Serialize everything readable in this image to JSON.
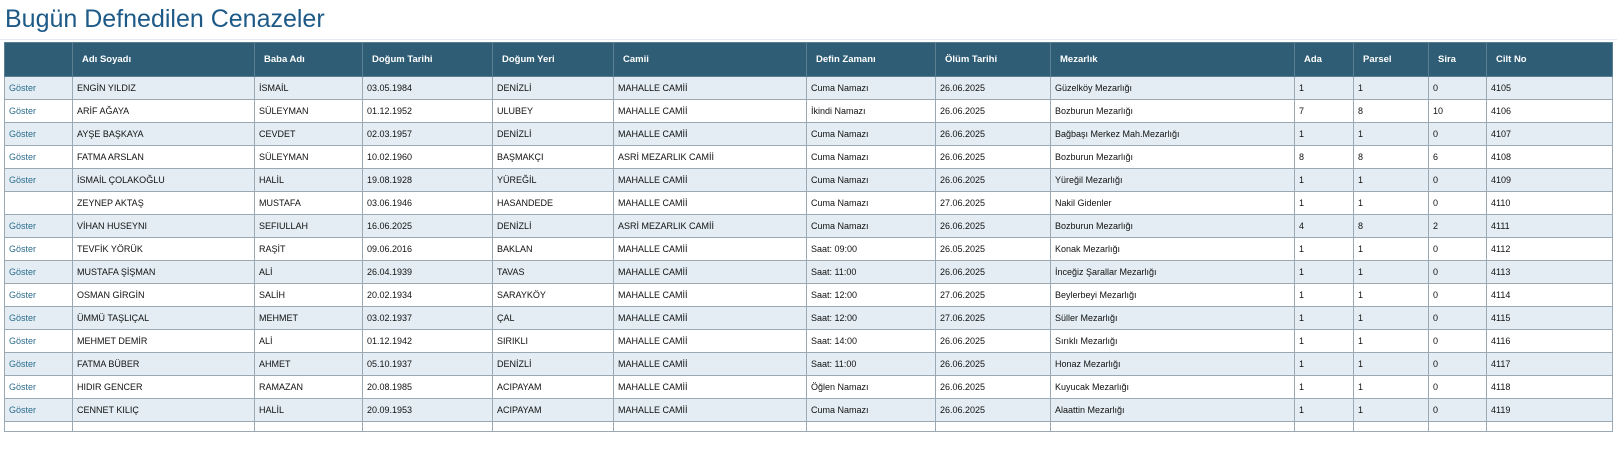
{
  "page": {
    "title": "Bugün Defnedilen Cenazeler"
  },
  "table": {
    "headers": [
      "",
      "Adı Soyadı",
      "Baba Adı",
      "Doğum Tarihi",
      "Doğum Yeri",
      "Camii",
      "Defin Zamanı",
      "Ölüm Tarihi",
      "Mezarlık",
      "Ada",
      "Parsel",
      "Sira",
      "Cilt No"
    ],
    "action_label": "Göster",
    "rows": [
      {
        "action": "Göster",
        "name": "ENGİN YILDIZ",
        "father": "İSMAİL",
        "birth_date": "03.05.1984",
        "birth_place": "DENİZLİ",
        "mosque": "MAHALLE CAMİİ",
        "burial_time": "Cuma Namazı",
        "death_date": "26.06.2025",
        "cemetery": "Güzelköy Mezarlığı",
        "ada": "1",
        "parsel": "1",
        "sira": "0",
        "cilt_no": "4105"
      },
      {
        "action": "Göster",
        "name": "ARİF AĞAYA",
        "father": "SÜLEYMAN",
        "birth_date": "01.12.1952",
        "birth_place": "ULUBEY",
        "mosque": "MAHALLE CAMİİ",
        "burial_time": "İkindi Namazı",
        "death_date": "26.06.2025",
        "cemetery": "Bozburun Mezarlığı",
        "ada": "7",
        "parsel": "8",
        "sira": "10",
        "cilt_no": "4106"
      },
      {
        "action": "Göster",
        "name": "AYŞE BAŞKAYA",
        "father": "CEVDET",
        "birth_date": "02.03.1957",
        "birth_place": "DENİZLİ",
        "mosque": "MAHALLE CAMİİ",
        "burial_time": "Cuma Namazı",
        "death_date": "26.06.2025",
        "cemetery": "Bağbaşı Merkez Mah.Mezarlığı",
        "ada": "1",
        "parsel": "1",
        "sira": "0",
        "cilt_no": "4107"
      },
      {
        "action": "Göster",
        "name": "FATMA ARSLAN",
        "father": "SÜLEYMAN",
        "birth_date": "10.02.1960",
        "birth_place": "BAŞMAKÇI",
        "mosque": "ASRİ MEZARLIK CAMİİ",
        "burial_time": "Cuma Namazı",
        "death_date": "26.06.2025",
        "cemetery": "Bozburun Mezarlığı",
        "ada": "8",
        "parsel": "8",
        "sira": "6",
        "cilt_no": "4108"
      },
      {
        "action": "Göster",
        "name": "İSMAİL ÇOLAKOĞLU",
        "father": "HALİL",
        "birth_date": "19.08.1928",
        "birth_place": "YÜREĞİL",
        "mosque": "MAHALLE CAMİİ",
        "burial_time": "Cuma Namazı",
        "death_date": "26.06.2025",
        "cemetery": "Yüreğil Mezarlığı",
        "ada": "1",
        "parsel": "1",
        "sira": "0",
        "cilt_no": "4109"
      },
      {
        "action": "",
        "name": "ZEYNEP AKTAŞ",
        "father": "MUSTAFA",
        "birth_date": "03.06.1946",
        "birth_place": "HASANDEDE",
        "mosque": "MAHALLE CAMİİ",
        "burial_time": "Cuma Namazı",
        "death_date": "27.06.2025",
        "cemetery": "Nakil Gidenler",
        "ada": "1",
        "parsel": "1",
        "sira": "0",
        "cilt_no": "4110"
      },
      {
        "action": "Göster",
        "name": "VİHAN HUSEYNI",
        "father": "SEFIULLAH",
        "birth_date": "16.06.2025",
        "birth_place": "DENİZLİ",
        "mosque": "ASRİ MEZARLIK CAMİİ",
        "burial_time": "Cuma Namazı",
        "death_date": "26.06.2025",
        "cemetery": "Bozburun Mezarlığı",
        "ada": "4",
        "parsel": "8",
        "sira": "2",
        "cilt_no": "4111"
      },
      {
        "action": "Göster",
        "name": "TEVFİK YÖRÜK",
        "father": "RAŞİT",
        "birth_date": "09.06.2016",
        "birth_place": "BAKLAN",
        "mosque": "MAHALLE CAMİİ",
        "burial_time": "Saat: 09:00",
        "death_date": "26.05.2025",
        "cemetery": "Konak Mezarlığı",
        "ada": "1",
        "parsel": "1",
        "sira": "0",
        "cilt_no": "4112"
      },
      {
        "action": "Göster",
        "name": "MUSTAFA ŞİŞMAN",
        "father": "ALİ",
        "birth_date": "26.04.1939",
        "birth_place": "TAVAS",
        "mosque": "MAHALLE CAMİİ",
        "burial_time": "Saat: 11:00",
        "death_date": "26.06.2025",
        "cemetery": "İnceğiz Şarallar Mezarlığı",
        "ada": "1",
        "parsel": "1",
        "sira": "0",
        "cilt_no": "4113"
      },
      {
        "action": "Göster",
        "name": "OSMAN GİRGİN",
        "father": "SALİH",
        "birth_date": "20.02.1934",
        "birth_place": "SARAYKÖY",
        "mosque": "MAHALLE CAMİİ",
        "burial_time": "Saat: 12:00",
        "death_date": "27.06.2025",
        "cemetery": "Beylerbeyi Mezarlığı",
        "ada": "1",
        "parsel": "1",
        "sira": "0",
        "cilt_no": "4114"
      },
      {
        "action": "Göster",
        "name": "ÜMMÜ TAŞLIÇAL",
        "father": "MEHMET",
        "birth_date": "03.02.1937",
        "birth_place": "ÇAL",
        "mosque": "MAHALLE CAMİİ",
        "burial_time": "Saat: 12:00",
        "death_date": "27.06.2025",
        "cemetery": "Süller Mezarlığı",
        "ada": "1",
        "parsel": "1",
        "sira": "0",
        "cilt_no": "4115"
      },
      {
        "action": "Göster",
        "name": "MEHMET DEMİR",
        "father": "ALİ",
        "birth_date": "01.12.1942",
        "birth_place": "SIRIKLI",
        "mosque": "MAHALLE CAMİİ",
        "burial_time": "Saat: 14:00",
        "death_date": "26.06.2025",
        "cemetery": "Sırıklı Mezarlığı",
        "ada": "1",
        "parsel": "1",
        "sira": "0",
        "cilt_no": "4116"
      },
      {
        "action": "Göster",
        "name": "FATMA BÜBER",
        "father": "AHMET",
        "birth_date": "05.10.1937",
        "birth_place": "DENİZLİ",
        "mosque": "MAHALLE CAMİİ",
        "burial_time": "Saat: 11:00",
        "death_date": "26.06.2025",
        "cemetery": "Honaz Mezarlığı",
        "ada": "1",
        "parsel": "1",
        "sira": "0",
        "cilt_no": "4117"
      },
      {
        "action": "Göster",
        "name": "HIDIR GENCER",
        "father": "RAMAZAN",
        "birth_date": "20.08.1985",
        "birth_place": "ACIPAYAM",
        "mosque": "MAHALLE CAMİİ",
        "burial_time": "Öğlen Namazı",
        "death_date": "26.06.2025",
        "cemetery": "Kuyucak Mezarlığı",
        "ada": "1",
        "parsel": "1",
        "sira": "0",
        "cilt_no": "4118"
      },
      {
        "action": "Göster",
        "name": "CENNET KILIÇ",
        "father": "HALİL",
        "birth_date": "20.09.1953",
        "birth_place": "ACIPAYAM",
        "mosque": "MAHALLE CAMİİ",
        "burial_time": "Cuma Namazı",
        "death_date": "26.06.2025",
        "cemetery": "Alaattin Mezarlığı",
        "ada": "1",
        "parsel": "1",
        "sira": "0",
        "cilt_no": "4119"
      }
    ]
  },
  "colors": {
    "title": "#1d5a87",
    "header_bg": "#2f5d75",
    "header_text": "#ffffff",
    "row_alt_bg": "#e3edf3",
    "link": "#2c6c8e"
  }
}
